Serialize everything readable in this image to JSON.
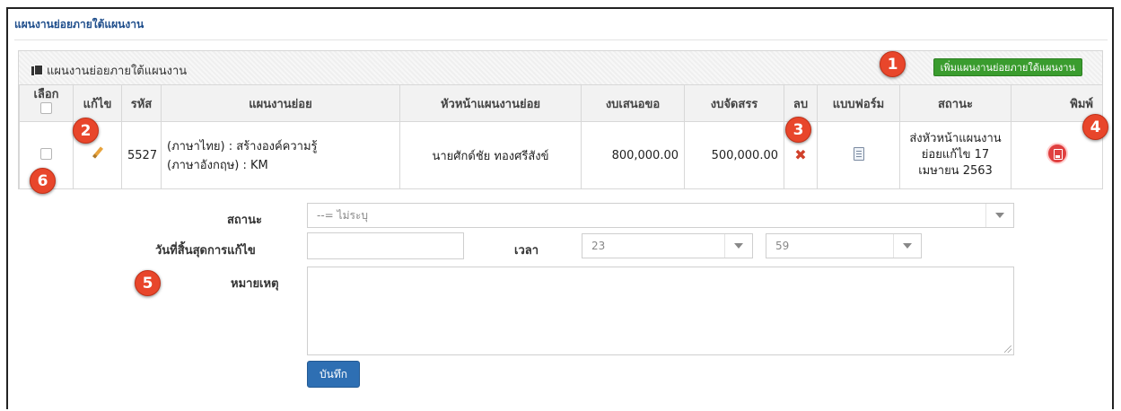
{
  "page": {
    "title": "แผนงานย่อยภายใต้แผนงาน"
  },
  "panel": {
    "title": "แผนงานย่อยภายใต้แผนงาน",
    "add_button": "เพิ่มแผนงานย่อยภายใต้แผนงาน"
  },
  "table": {
    "headers": {
      "select": "เลือก",
      "edit": "แก้ไข",
      "code": "รหัส",
      "subplan": "แผนงานย่อย",
      "head": "หัวหน้าแผนงานย่อย",
      "budget_requested": "งบเสนอขอ",
      "budget_allocated": "งบจัดสรร",
      "delete": "ลบ",
      "form": "แบบฟอร์ม",
      "status": "สถานะ",
      "print": "พิมพ์"
    },
    "rows": [
      {
        "code": "5527",
        "name_th": "(ภาษาไทย) : สร้างองค์ความรู้",
        "name_en": "(ภาษาอังกฤษ) : KM",
        "head": "นายศักด์ชัย ทองศรีสังข์",
        "budget_requested": "800,000.00",
        "budget_allocated": "500,000.00",
        "status": "ส่งหัวหน้าแผนงานย่อยแก้ไข 17 เมษายน 2563"
      }
    ]
  },
  "form": {
    "status_label": "สถานะ",
    "status_value": "--= ไม่ระบุ",
    "deadline_label": "วันที่สิ้นสุดการแก้ไข",
    "deadline_value": "",
    "time_label": "เวลา",
    "hour_value": "23",
    "minute_value": "59",
    "note_label": "หมายเหตุ",
    "note_value": "",
    "save_button": "บันทึก"
  },
  "badges": [
    "1",
    "2",
    "3",
    "4",
    "5",
    "6"
  ],
  "colors": {
    "title_blue": "#1f4e8c",
    "add_green": "#3a9c2e",
    "save_blue": "#2e6fb3",
    "badge_red": "#e8462b",
    "delete_red": "#d0402a"
  },
  "icons": [
    "copy-icon",
    "pencil-icon",
    "delete-x-icon",
    "document-icon",
    "print-icon"
  ]
}
